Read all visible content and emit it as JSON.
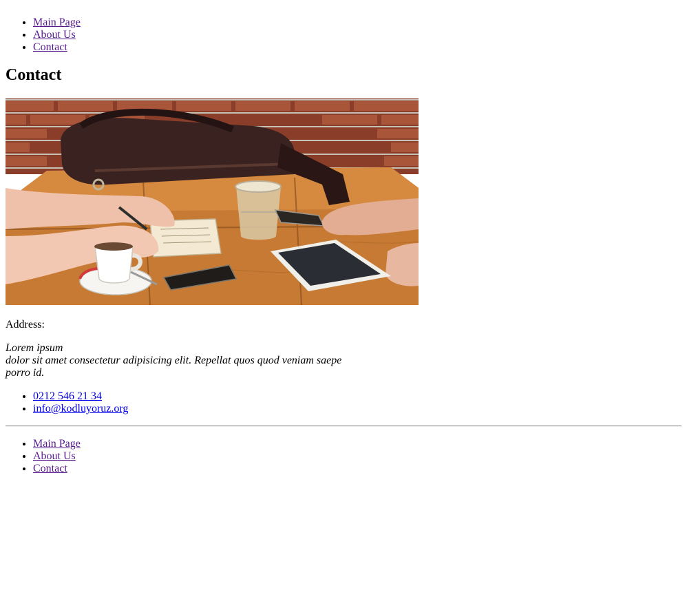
{
  "header_nav": [
    {
      "label": "Main Page"
    },
    {
      "label": "About Us"
    },
    {
      "label": "Contact"
    }
  ],
  "page_title": "Contact",
  "address": {
    "label": "Address:",
    "line1": "Lorem ipsum",
    "line2": "dolor sit amet consectetur adipisicing elit. Repellat quos quod veniam saepe porro id."
  },
  "contact_links": {
    "phone": "0212 546 21 34",
    "email": "info@kodluyoruz.org"
  },
  "footer_nav": [
    {
      "label": "Main Page"
    },
    {
      "label": "About Us"
    },
    {
      "label": "Contact"
    }
  ],
  "colors": {
    "visited_link": "#551a8b",
    "unvisited_link": "#0000ee"
  }
}
